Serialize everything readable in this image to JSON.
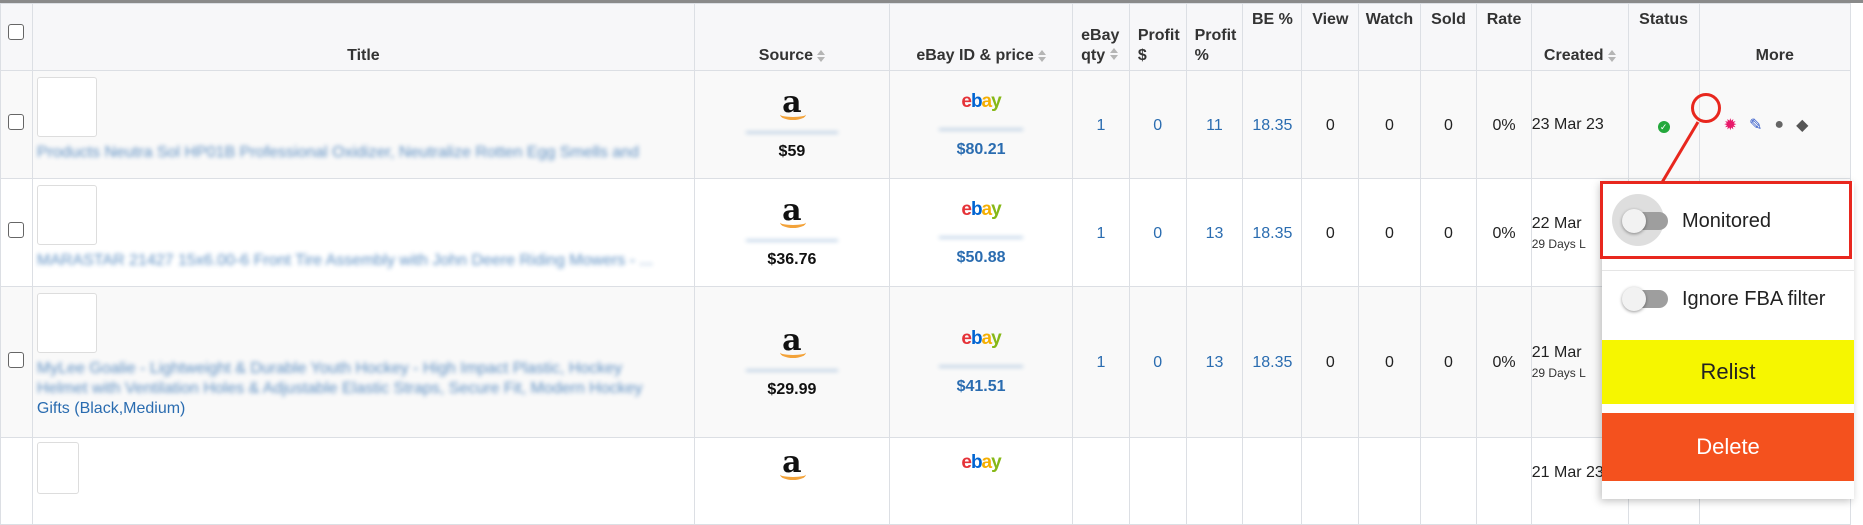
{
  "table": {
    "columns": {
      "title": "Title",
      "source": "Source",
      "ebay_id_price": "eBay ID & price",
      "ebay_qty": [
        "eBay",
        "qty"
      ],
      "profit_usd": [
        "Profit",
        "$"
      ],
      "profit_pct": [
        "Profit",
        "%"
      ],
      "be_pct": "BE %",
      "view": "View",
      "watch": "Watch",
      "sold": "Sold",
      "rate": "Rate",
      "created": "Created",
      "status": "Status",
      "more": "More"
    },
    "rows": [
      {
        "title": "Products Neutra Sol HP01B Professional Oxidizer, Neutralize Rotten Egg Smells and",
        "source_price": "$59",
        "ebay_price": "$80.21",
        "ebay_qty": "1",
        "profit_usd": "0",
        "profit_pct": "11",
        "be_pct": "18.35",
        "view": "0",
        "watch": "0",
        "sold": "0",
        "rate": "0%",
        "created": "23 Mar 23",
        "created_sub": ""
      },
      {
        "title": "MARASTAR 21427 15x6.00-6 Front Tire Assembly with John Deere Riding Mowers - ...",
        "source_price": "$36.76",
        "ebay_price": "$50.88",
        "ebay_qty": "1",
        "profit_usd": "0",
        "profit_pct": "13",
        "be_pct": "18.35",
        "view": "0",
        "watch": "0",
        "sold": "0",
        "rate": "0%",
        "created": "22 Mar",
        "created_sub": "29 Days L"
      },
      {
        "title_line1": "MyLee Goalie - Lightweight & Durable Youth Hockey - High Impact Plastic, Hockey",
        "title_line2": "Helmet with Ventilation Holes & Adjustable Elastic Straps, Secure Fit, Modern Hockey",
        "title_line3": "Gifts (Black,Medium)",
        "source_price": "$29.99",
        "ebay_price": "$41.51",
        "ebay_qty": "1",
        "profit_usd": "0",
        "profit_pct": "13",
        "be_pct": "18.35",
        "view": "0",
        "watch": "0",
        "sold": "0",
        "rate": "0%",
        "created": "21 Mar",
        "created_sub": "29 Days L"
      },
      {
        "created": "21 Mar 23"
      }
    ]
  },
  "logos": {
    "amazon": "a",
    "ebay": [
      "e",
      "b",
      "a",
      "y"
    ]
  },
  "popup": {
    "monitored_label": "Monitored",
    "ignore_fba_label": "Ignore FBA filter",
    "relist_label": "Relist",
    "delete_label": "Delete"
  },
  "icons": [
    "checkbox",
    "status-ok-icon",
    "gear-icon",
    "pencil-icon",
    "comment-icon",
    "tag-icon"
  ],
  "colors": {
    "link": "#2a6cb0",
    "status_ok": "#24a83c",
    "gear": "#e8196a",
    "relist_bg": "#f6f600",
    "delete_bg": "#f4511e",
    "annotation": "#e8271e"
  }
}
